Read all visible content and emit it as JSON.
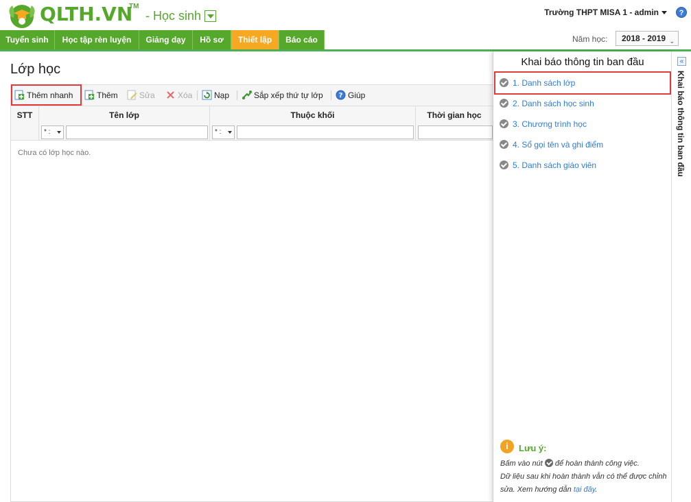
{
  "header": {
    "logo_text": "QLTH.VN",
    "logo_tm": "TM",
    "module_label": "- Học sinh",
    "school_user": "Trường THPT MISA 1 - admin",
    "help_glyph": "?"
  },
  "nav": {
    "items": [
      {
        "label": "Tuyển sinh"
      },
      {
        "label": "Học tập rèn luyện"
      },
      {
        "label": "Giảng dạy"
      },
      {
        "label": "Hồ sơ"
      },
      {
        "label": "Thiết lập",
        "active": true
      },
      {
        "label": "Báo cáo"
      }
    ],
    "year_label": "Năm học:",
    "year_value": "2018 - 2019"
  },
  "main": {
    "title": "Lớp học",
    "toolbar": {
      "quick_add": "Thêm nhanh",
      "add": "Thêm",
      "edit": "Sửa",
      "delete": "Xóa",
      "reload": "Nạp",
      "sort": "Sắp xếp thứ tự lớp",
      "help": "Giúp"
    },
    "grid": {
      "columns": [
        "STT",
        "Tên lớp",
        "Thuộc khối",
        "Thời gian học"
      ],
      "filter_op": "* :",
      "empty_text": "Chưa có lớp học nào."
    }
  },
  "panel": {
    "title": "Khai báo thông tin ban đầu",
    "steps": [
      {
        "label": "1. Danh sách lớp"
      },
      {
        "label": "2. Danh sách học sinh"
      },
      {
        "label": "3. Chương trình học"
      },
      {
        "label": "4. Sổ gọi tên và ghi điểm"
      },
      {
        "label": "5. Danh sách giáo viên"
      }
    ],
    "note_icon": "i",
    "note_title": "Lưu ý:",
    "note_line1_a": "Bấm vào nút",
    "note_line1_b": "để hoàn thành công việc.",
    "note_line2": "Dữ liệu sau khi hoàn thành vẫn có thể được chỉnh sửa. Xem hướng dẫn",
    "note_link": "tại đây",
    "note_end": "."
  },
  "side_tab": {
    "collapse_glyph": "«",
    "label": "Khai báo thông tin ban đầu"
  },
  "colors": {
    "brand_green": "#55a82b",
    "active_tab": "#f7a823",
    "highlight_red": "#e03a3a",
    "link_blue": "#2c7bd8"
  }
}
